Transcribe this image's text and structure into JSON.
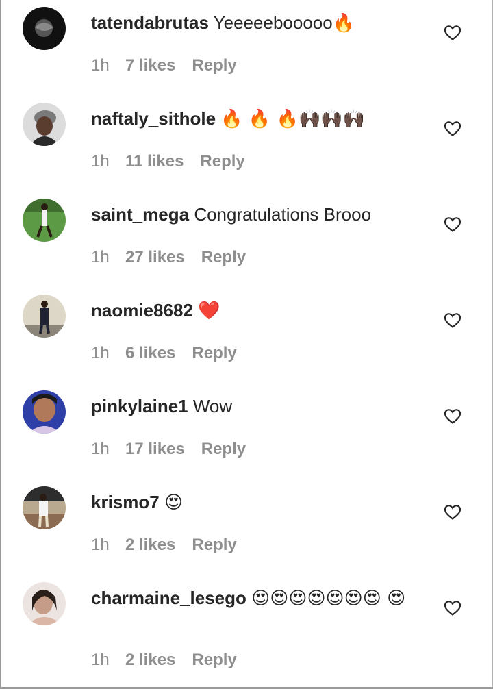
{
  "comments": [
    {
      "username": "tatendabrutas",
      "text": "Yeeeeebooooo",
      "emoji": "🔥",
      "time": "1h",
      "likes": "7 likes",
      "reply": "Reply",
      "avatar_bg": "#111111",
      "avatar_fg": "#666666"
    },
    {
      "username": "naftaly_sithole",
      "text": "",
      "emoji": "🔥 🔥 🔥🙌🏿🙌🏿🙌🏿",
      "time": "1h",
      "likes": "11 likes",
      "reply": "Reply",
      "avatar_bg": "#d8d8d8",
      "avatar_fg": "#3a3a3a"
    },
    {
      "username": "saint_mega",
      "text": "Congratulations Brooo",
      "emoji": "",
      "time": "1h",
      "likes": "27 likes",
      "reply": "Reply",
      "avatar_bg": "#4f8a3c",
      "avatar_fg": "#f2f2f2"
    },
    {
      "username": "naomie8682",
      "text": "",
      "emoji": "❤️",
      "time": "1h",
      "likes": "6 likes",
      "reply": "Reply",
      "avatar_bg": "#d9d4c4",
      "avatar_fg": "#2a2a3a"
    },
    {
      "username": "pinkylaine1",
      "text": "Wow",
      "emoji": "",
      "time": "1h",
      "likes": "17 likes",
      "reply": "Reply",
      "avatar_bg": "#2f3fa8",
      "avatar_fg": "#b07a5a"
    },
    {
      "username": "krismo7",
      "text": "",
      "emoji": "😍",
      "time": "1h",
      "likes": "2 likes",
      "reply": "Reply",
      "avatar_bg": "#b8a890",
      "avatar_fg": "#f4f4f4"
    },
    {
      "username": "charmaine_lesego",
      "text": "",
      "emoji": "😍😍😍😍😍😍😍 😍",
      "time": "1h",
      "likes": "2 likes",
      "reply": "Reply",
      "avatar_bg": "#e8e0dc",
      "avatar_fg": "#c09a88"
    }
  ],
  "colors": {
    "text": "#262626",
    "meta": "#8e8e8e",
    "heart_outline": "#262626"
  }
}
